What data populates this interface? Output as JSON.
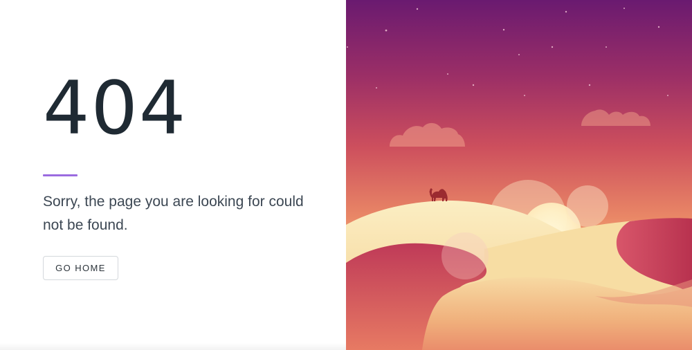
{
  "error": {
    "code": "404",
    "message": "Sorry, the page you are looking for could not be found.",
    "home_button_label": "GO HOME"
  },
  "illustration": {
    "subject": "desert sunset with sand dunes and camel",
    "icons": [
      "camel-icon",
      "sun-icon",
      "cloud-icon",
      "star-icon"
    ]
  },
  "colors": {
    "accent_rule": "#9b6be0",
    "heading_text": "#1f2a33",
    "body_text": "#3c4753",
    "button_border": "#d4d8dc",
    "sky_top": "#6a1a70",
    "sky_mid": "#c4445c",
    "sky_bottom": "#f6d49a"
  }
}
